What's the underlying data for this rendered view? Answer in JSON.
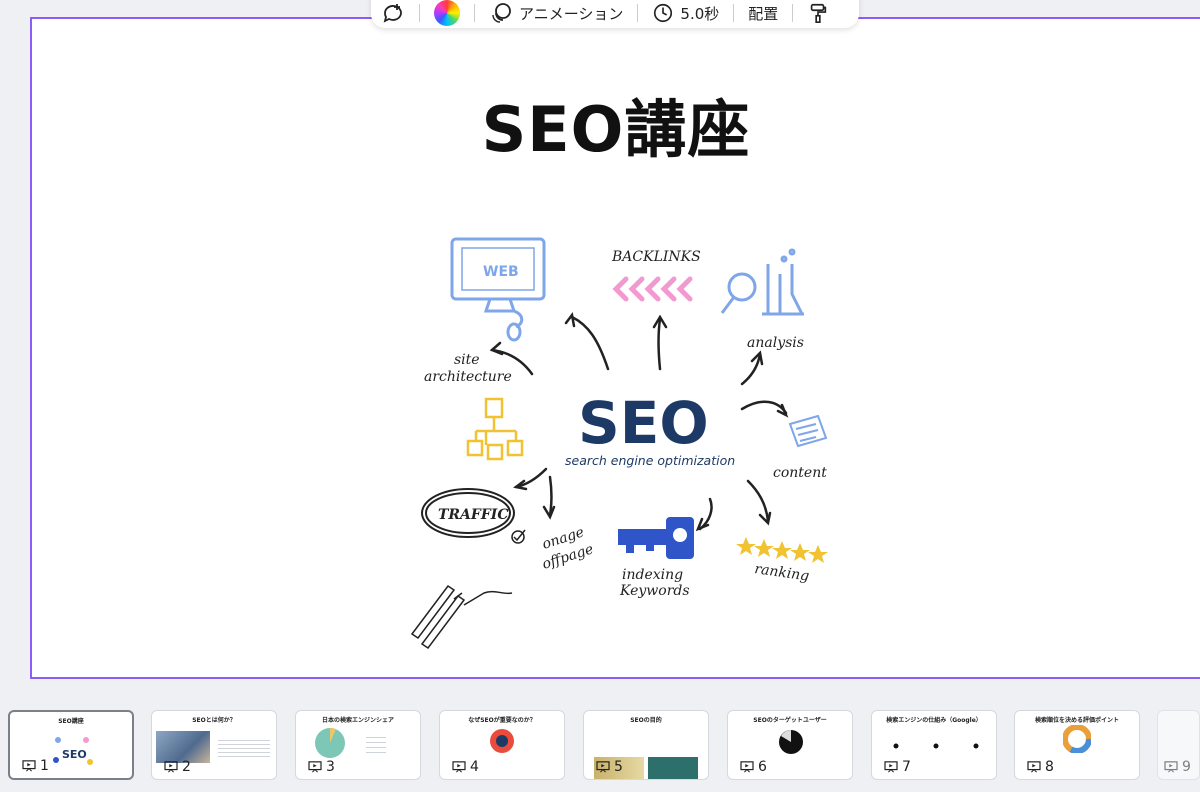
{
  "toolbar": {
    "animation_label": "アニメーション",
    "duration_label": "5.0秒",
    "position_label": "配置"
  },
  "slide": {
    "title": "SEO講座",
    "center_title": "SEO",
    "center_subtitle": "search engine optimization",
    "labels": {
      "backlinks": "BACKLINKS",
      "web": "WEB",
      "analysis": "analysis",
      "site1": "site",
      "site2": "architecture",
      "content": "content",
      "traffic": "TRAFFIC",
      "onage": "onage",
      "offpage": "offpage",
      "indexing": "indexing",
      "keywords": "Keywords",
      "ranking": "ranking"
    }
  },
  "thumbnails": [
    {
      "num": "1",
      "title": "SEO講座"
    },
    {
      "num": "2",
      "title": "SEOとは何か？"
    },
    {
      "num": "3",
      "title": "日本の検索エンジンシェア"
    },
    {
      "num": "4",
      "title": "なぜSEOが重要なのか？"
    },
    {
      "num": "5",
      "title": "SEOの目的"
    },
    {
      "num": "6",
      "title": "SEOのターゲットユーザー"
    },
    {
      "num": "7",
      "title": "検索エンジンの仕組み（Google）"
    },
    {
      "num": "8",
      "title": "検索順位を決める評価ポイント"
    },
    {
      "num": "9",
      "title": ""
    }
  ],
  "colors": {
    "accent": "#8b5cf6",
    "seo_navy": "#1d3a66",
    "web_blue": "#7fa6e8",
    "backlink_pink": "#f29ad0",
    "yellow": "#f1c232",
    "key_blue": "#2f55c8"
  }
}
